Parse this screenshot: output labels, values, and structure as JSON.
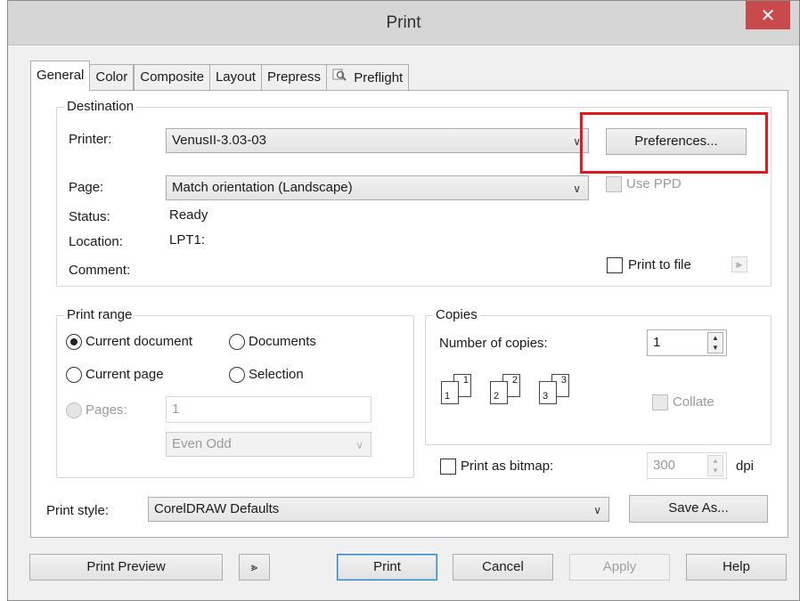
{
  "window": {
    "title": "Print",
    "close_glyph": "✕"
  },
  "tabs": [
    {
      "label": "General",
      "active": true
    },
    {
      "label": "Color"
    },
    {
      "label": "Composite"
    },
    {
      "label": "Layout"
    },
    {
      "label": "Prepress"
    },
    {
      "label": "Preflight",
      "icon": "magnifier-icon"
    }
  ],
  "destination": {
    "legend": "Destination",
    "printer_label": "Printer:",
    "printer_value": "VenusII-3.03-03",
    "preferences_button": "Preferences...",
    "page_label": "Page:",
    "page_value": "Match orientation (Landscape)",
    "use_ppd_label": "Use PPD",
    "status_label": "Status:",
    "status_value": "Ready",
    "location_label": "Location:",
    "location_value": "LPT1:",
    "comment_label": "Comment:",
    "print_to_file_label": "Print to file"
  },
  "print_range": {
    "legend": "Print range",
    "current_document": "Current document",
    "documents": "Documents",
    "current_page": "Current page",
    "selection": "Selection",
    "pages_label": "Pages:",
    "pages_value": "1",
    "even_odd_value": "Even Odd",
    "selected": "current_document"
  },
  "copies": {
    "legend": "Copies",
    "number_label": "Number of copies:",
    "number_value": "1",
    "collate_label": "Collate",
    "icons": [
      {
        "back": "1",
        "front": "1"
      },
      {
        "back": "2",
        "front": "2"
      },
      {
        "back": "3",
        "front": "3"
      }
    ]
  },
  "bitmap": {
    "label": "Print as bitmap:",
    "dpi_value": "300",
    "dpi_unit": "dpi"
  },
  "print_style": {
    "label": "Print style:",
    "value": "CorelDRAW Defaults",
    "save_as_button": "Save As..."
  },
  "footer": {
    "print_preview": "Print Preview",
    "preview_toggle_glyph": "⪢",
    "print": "Print",
    "cancel": "Cancel",
    "apply": "Apply",
    "help": "Help"
  },
  "colors": {
    "highlight": "#e0191e",
    "close": "#c94a4a"
  }
}
